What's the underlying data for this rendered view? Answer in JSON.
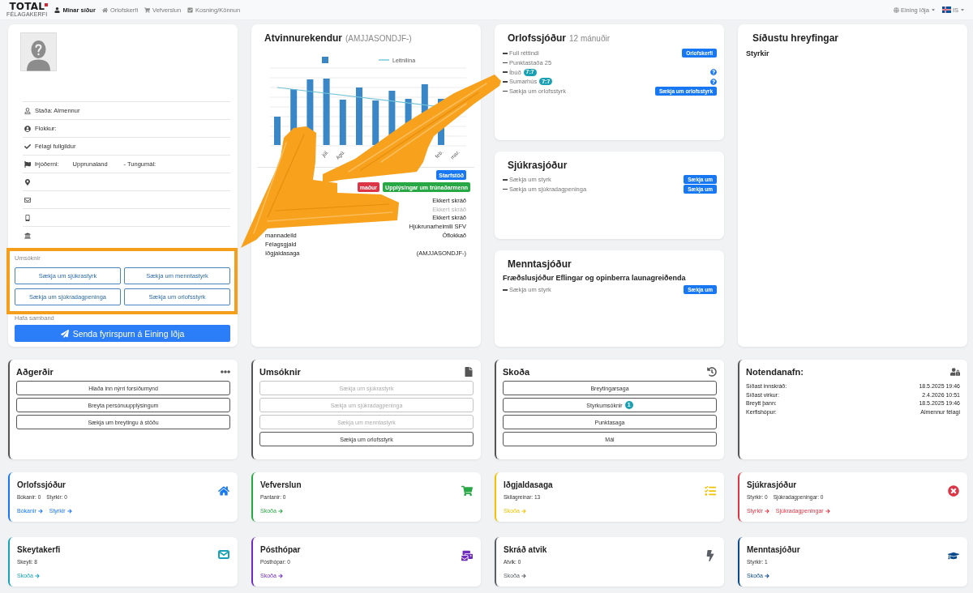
{
  "top_nav": {
    "logo": {
      "text": "TOTAL",
      "subtitle": "FÉLAGAKERFI"
    },
    "items": [
      {
        "label": "Minar síður",
        "selected": true
      },
      {
        "label": "Orlofskerfi",
        "selected": false
      },
      {
        "label": "Vefverslun",
        "selected": false
      },
      {
        "label": "Kosning/Könnun",
        "selected": false
      }
    ],
    "union_menu": "Eining Iðja",
    "language_menu": "IS"
  },
  "profile": {
    "rows": [
      {
        "kind": "status",
        "text": "Staða: Almennur"
      },
      {
        "kind": "category",
        "text": "Flokkur:"
      },
      {
        "kind": "membership",
        "text": "Félagi fullgildur"
      },
      {
        "kind": "nationality",
        "texts": [
          "Þjóðerni:",
          "Upprunaland",
          "- Tungumál:"
        ]
      },
      {
        "kind": "address"
      },
      {
        "kind": "email"
      },
      {
        "kind": "phone"
      },
      {
        "kind": "bank"
      }
    ],
    "applications": {
      "label": "Umsóknir",
      "highlighted": true,
      "buttons": [
        "Sækja um sjúkrastyrk",
        "Sækja um menntastyrk",
        "Sækja um sjúkradagpeninga",
        "Sækja um orlofsstyrk"
      ]
    },
    "contact": {
      "label": "Hafa samband",
      "button": "Senda fyrirspurn á Eining Iðja"
    }
  },
  "employers": {
    "title": "Atvinnurekendur",
    "period": "(AMJJASONDJF-)",
    "chart": {
      "legend_label": "Leitnilína",
      "x_labels": [
        "júl.",
        "ágú.",
        "feb.",
        "mar."
      ]
    },
    "badge_rows": [
      [
        {
          "text": "Starfstöð",
          "color": "#1877f2"
        }
      ],
      [
        {
          "text": "maður",
          "color": "#dc3545"
        },
        {
          "text": "Upplýsingar um trúnaðarmenn",
          "color": "#28a745"
        }
      ]
    ],
    "rows": [
      {
        "value": "Ekkert skráð",
        "muted": false
      },
      {
        "value": "Ekkert skráð",
        "muted": true
      },
      {
        "value": "Ekkert skráð",
        "muted": false
      },
      {
        "value": "Hjúkrunarheimili SFV",
        "muted": false
      },
      {
        "label": "mannadeild",
        "value": "Óflokkað",
        "muted": false
      },
      {
        "label": "Félagsgjald"
      },
      {
        "label": "Iðgjaldasaga",
        "value": "(AMJJASONDJF-)",
        "muted": false
      }
    ]
  },
  "holiday_fund": {
    "title": "Orlofssjóður",
    "period": "12 mánuðir",
    "items": [
      {
        "label": "Full réttindi",
        "button": "Orlofskerfi"
      },
      {
        "label": "Punktastaða 25"
      },
      {
        "label": "Íbúð",
        "badge": "7:7",
        "help": true
      },
      {
        "label": "Sumarhús",
        "badge": "7:7",
        "help": true
      },
      {
        "label": "Sækja um orlofsstyrk",
        "button": "Sækja um orlofsstyrk"
      }
    ]
  },
  "sickness_fund": {
    "title": "Sjúkrasjóður",
    "items": [
      {
        "label": "Sækja um styrk",
        "button": "Sækja um"
      },
      {
        "label": "Sækja um sjúkradagpeninga",
        "button": "Sækja um"
      }
    ]
  },
  "education_fund": {
    "title": "Menntasjóður",
    "subtitle": "Fræðslusjóður Eflingar og opinberra launagreiðenda",
    "items": [
      {
        "label": "Sækja um styrk",
        "button": "Sækja um"
      }
    ]
  },
  "recent_activity": {
    "title": "Síðustu hreyfingar",
    "section": "Styrkir"
  },
  "panels": [
    {
      "kind": "buttons",
      "title": "Aðgerðir",
      "buttons": [
        {
          "label": "Hlaða inn nýrri forsíðumynd",
          "disabled": false
        },
        {
          "label": "Breyta persónuupplýsingum",
          "disabled": false
        },
        {
          "label": "Sækja um breytingu á stöðu",
          "disabled": false
        }
      ]
    },
    {
      "kind": "buttons",
      "title": "Umsóknir",
      "buttons": [
        {
          "label": "Sækja um sjúkrastyrk",
          "disabled": true
        },
        {
          "label": "Sækja um sjúkradagpeninga",
          "disabled": true
        },
        {
          "label": "Sækja um menntastyrk",
          "disabled": true
        },
        {
          "label": "Sækja um orlofsstyrk",
          "disabled": false
        }
      ]
    },
    {
      "kind": "buttons",
      "title": "Skoða",
      "buttons": [
        {
          "label": "Breytingarsaga",
          "disabled": false
        },
        {
          "label": "Styrkumsóknir",
          "badge": "1",
          "disabled": false
        },
        {
          "label": "Punktasaga",
          "disabled": false
        },
        {
          "label": "Mál",
          "disabled": false
        }
      ]
    },
    {
      "kind": "details",
      "title": "Notendanafn:",
      "rows": [
        {
          "label": "Síðast innskráð:",
          "value": "18.5.2025 19:46"
        },
        {
          "label": "Síðast virkur:",
          "value": "2.4.2026 10:51"
        },
        {
          "label": "Breytt þann:",
          "value": "18.5.2025 19:46"
        },
        {
          "label": "Kerfishópur:",
          "value": "Almennur félagi"
        }
      ]
    }
  ],
  "summary_cards": [
    {
      "title": "Orlofssjóður",
      "color": "#1877f2",
      "stats": [
        "Bókanir: 0",
        "Styrkir: 0"
      ],
      "links": [
        "Bókanir",
        "Styrkir"
      ]
    },
    {
      "title": "Vefverslun",
      "color": "#28a745",
      "stats": [
        "Pantanir: 0"
      ],
      "links": [
        "Skoða"
      ]
    },
    {
      "title": "Iðgjaldasaga",
      "color": "#f2c200",
      "stats": [
        "Skilagreinar: 13"
      ],
      "links": [
        "Skoða"
      ]
    },
    {
      "title": "Sjúkrasjóður",
      "color": "#dc3545",
      "stats": [
        "Styrkir: 0",
        "Sjúkradagpeningar: 0"
      ],
      "links": [
        "Styrkir",
        "Sjúkradagpeningar"
      ]
    },
    {
      "title": "Skeytakerfi",
      "color": "#17a2b8",
      "stats": [
        "Skeyti: 8"
      ],
      "links": [
        "Skoða"
      ]
    },
    {
      "title": "Pósthópar",
      "color": "#6f2dbd",
      "stats": [
        "Pósthópar: 0"
      ],
      "links": [
        "Skoða"
      ]
    },
    {
      "title": "Skráð atvik",
      "color": "#5a5f66",
      "stats": [
        "Atvik: 0"
      ],
      "links": [
        "Skoða"
      ]
    },
    {
      "title": "Menntasjóður",
      "color": "#0b4a8b",
      "stats": [
        "Styrkir: 1"
      ],
      "links": [
        "Skoða"
      ]
    }
  ]
}
